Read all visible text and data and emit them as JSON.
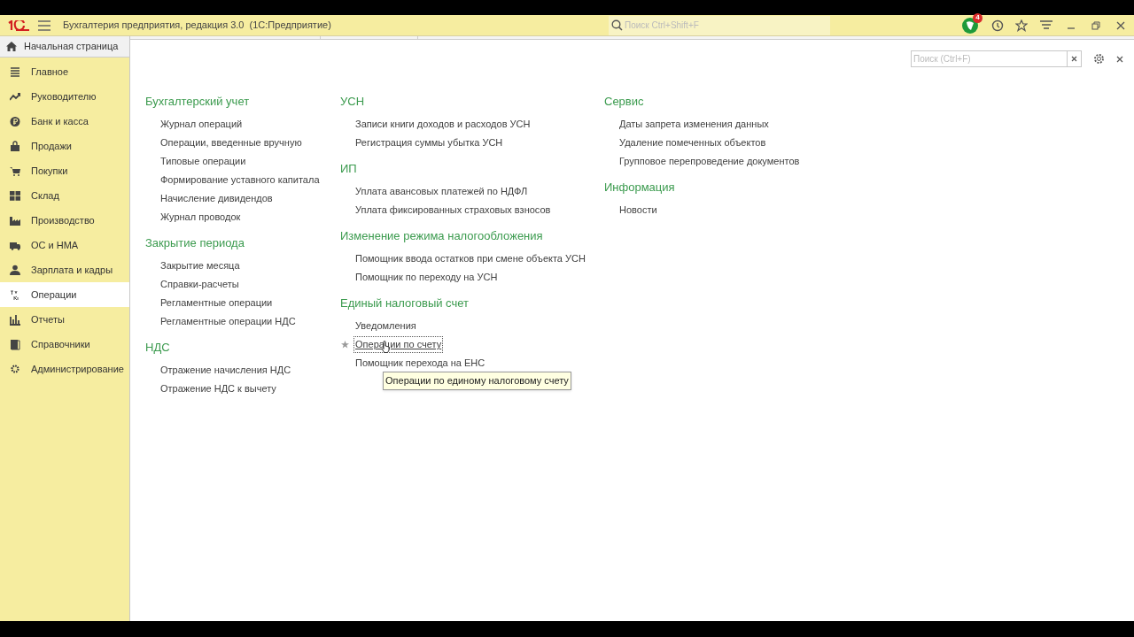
{
  "window": {
    "title": "Бухгалтерия предприятия, редакция 3.0  (1С:Предприятие)",
    "search_placeholder": "Поиск Ctrl+Shift+F",
    "notification_count": "4"
  },
  "home_tab": {
    "label": "Начальная страница"
  },
  "sidebar": {
    "items": [
      {
        "label": "Главное",
        "selected": false
      },
      {
        "label": "Руководителю",
        "selected": false
      },
      {
        "label": "Банк и касса",
        "selected": false
      },
      {
        "label": "Продажи",
        "selected": false
      },
      {
        "label": "Покупки",
        "selected": false
      },
      {
        "label": "Склад",
        "selected": false
      },
      {
        "label": "Производство",
        "selected": false
      },
      {
        "label": "ОС и НМА",
        "selected": false
      },
      {
        "label": "Зарплата и кадры",
        "selected": false
      },
      {
        "label": "Операции",
        "selected": true
      },
      {
        "label": "Отчеты",
        "selected": false
      },
      {
        "label": "Справочники",
        "selected": false
      },
      {
        "label": "Администрирование",
        "selected": false
      }
    ]
  },
  "panel": {
    "search_placeholder": "Поиск (Ctrl+F)"
  },
  "columns": [
    {
      "groups": [
        {
          "title": "Бухгалтерский учет",
          "items": [
            {
              "label": "Журнал операций",
              "focused": false
            },
            {
              "label": "Операции, введенные вручную",
              "focused": false
            },
            {
              "label": "Типовые операции",
              "focused": false
            },
            {
              "label": "Формирование уставного капитала",
              "focused": false
            },
            {
              "label": "Начисление дивидендов",
              "focused": false
            },
            {
              "label": "Журнал проводок",
              "focused": false
            }
          ]
        },
        {
          "title": "Закрытие периода",
          "items": [
            {
              "label": "Закрытие месяца",
              "focused": false
            },
            {
              "label": "Справки-расчеты",
              "focused": false
            },
            {
              "label": "Регламентные операции",
              "focused": false
            },
            {
              "label": "Регламентные операции НДС",
              "focused": false
            }
          ]
        },
        {
          "title": "НДС",
          "items": [
            {
              "label": "Отражение начисления НДС",
              "focused": false
            },
            {
              "label": "Отражение НДС к вычету",
              "focused": false
            }
          ]
        }
      ]
    },
    {
      "groups": [
        {
          "title": "УСН",
          "items": [
            {
              "label": "Записи книги доходов и расходов УСН",
              "focused": false
            },
            {
              "label": "Регистрация суммы убытка УСН",
              "focused": false
            }
          ]
        },
        {
          "title": "ИП",
          "items": [
            {
              "label": "Уплата авансовых платежей по НДФЛ",
              "focused": false
            },
            {
              "label": "Уплата фиксированных страховых взносов",
              "focused": false
            }
          ]
        },
        {
          "title": "Изменение режима налогообложения",
          "items": [
            {
              "label": "Помощник ввода остатков при смене объекта УСН",
              "focused": false
            },
            {
              "label": "Помощник по переходу на УСН",
              "focused": false
            }
          ]
        },
        {
          "title": "Единый налоговый счет",
          "items": [
            {
              "label": "Уведомления",
              "focused": false
            },
            {
              "label": "Операции по счету",
              "focused": true,
              "tooltip": "Операции по единому налоговому счету"
            },
            {
              "label": "Помощник перехода на ЕНС",
              "focused": false
            }
          ]
        }
      ]
    },
    {
      "groups": [
        {
          "title": "Сервис",
          "items": [
            {
              "label": "Даты запрета изменения данных",
              "focused": false
            },
            {
              "label": "Удаление помеченных объектов",
              "focused": false
            },
            {
              "label": "Групповое перепроведение документов",
              "focused": false
            }
          ]
        },
        {
          "title": "Информация",
          "items": [
            {
              "label": "Новости",
              "focused": false
            }
          ]
        }
      ]
    }
  ]
}
